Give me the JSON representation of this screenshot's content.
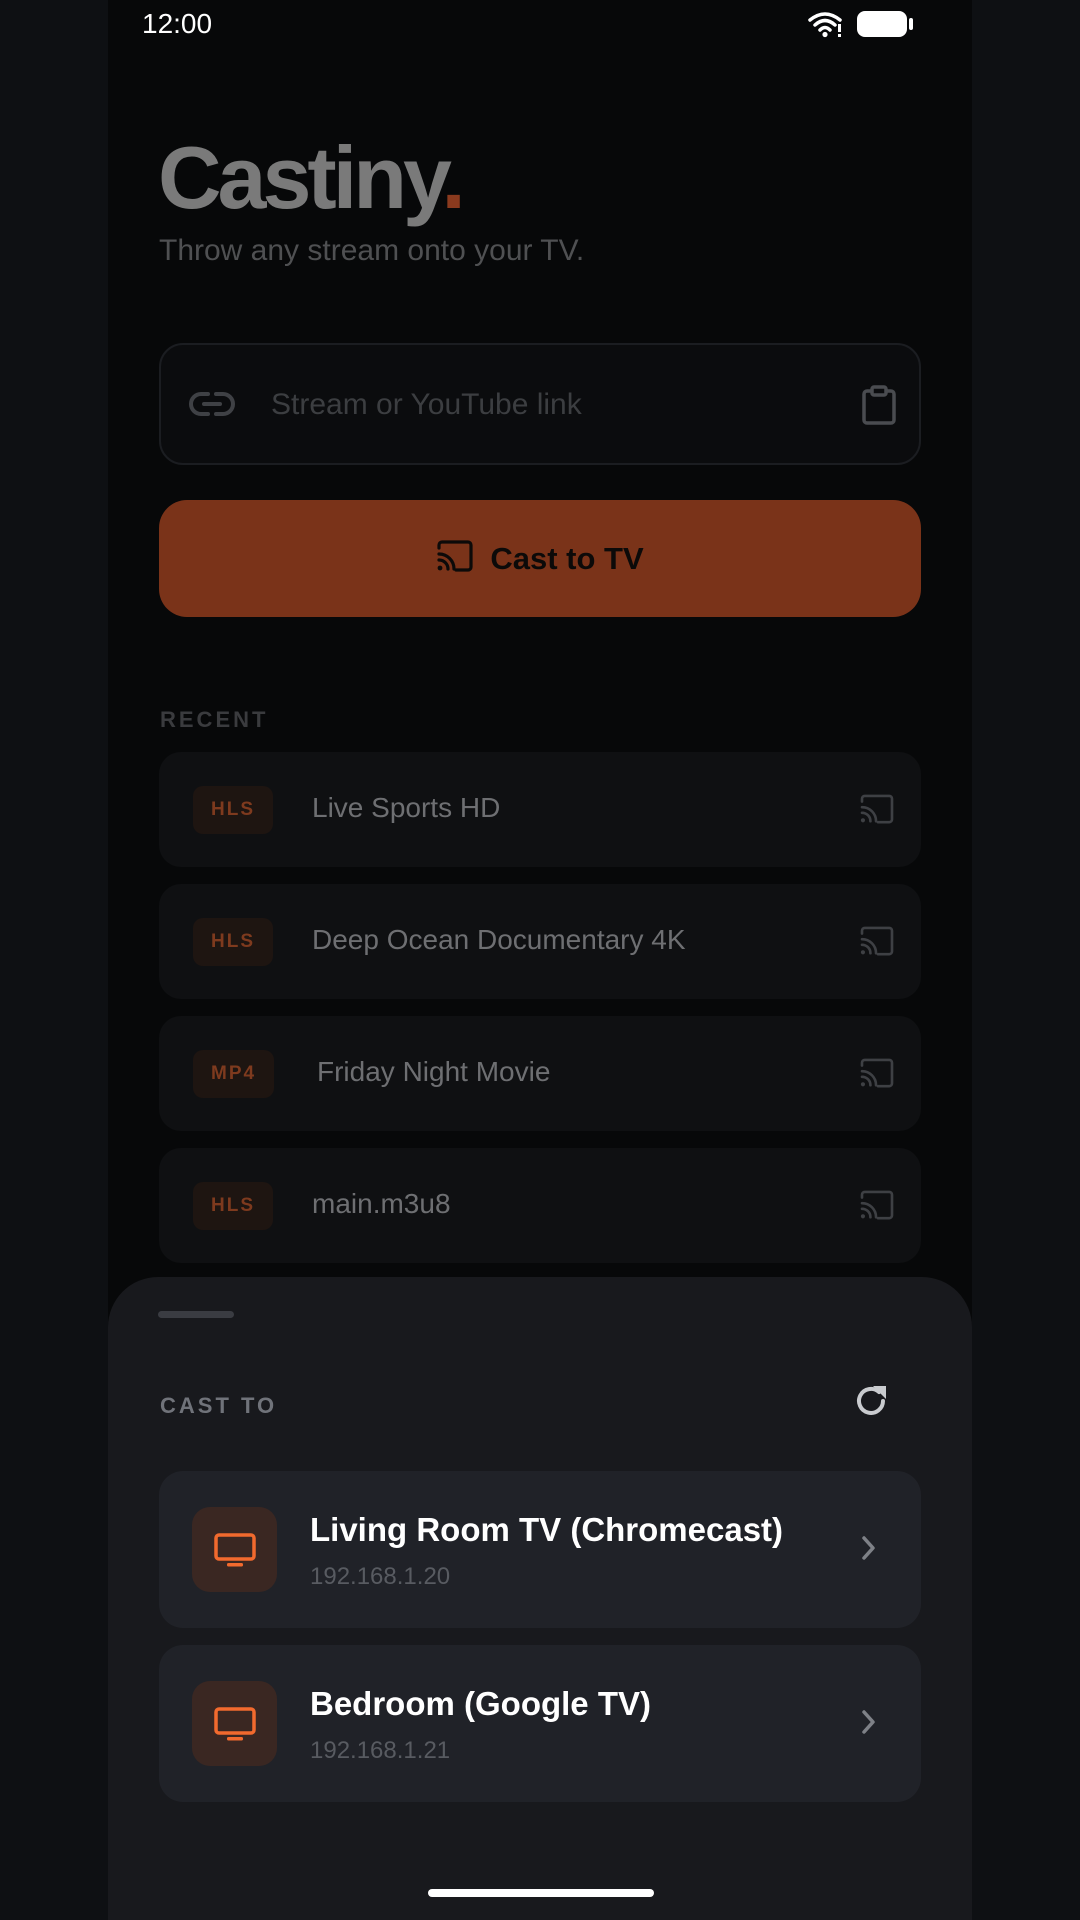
{
  "status": {
    "time": "12:00"
  },
  "brand": {
    "name": "Castiny",
    "dot": ".",
    "tagline": "Throw any stream onto your TV."
  },
  "input": {
    "placeholder": "Stream or YouTube link",
    "value": ""
  },
  "cast_button": {
    "label": "Cast to TV"
  },
  "recent": {
    "label": "RECENT",
    "items": [
      {
        "badge": "HLS",
        "title": "Live Sports HD"
      },
      {
        "badge": "HLS",
        "title": "Deep Ocean Documentary 4K"
      },
      {
        "badge": "MP4",
        "title": "Friday Night Movie"
      },
      {
        "badge": "HLS",
        "title": "main.m3u8"
      }
    ]
  },
  "sheet": {
    "label": "CAST TO",
    "devices": [
      {
        "name": "Living Room TV (Chromecast)",
        "ip": "192.168.1.20"
      },
      {
        "name": "Bedroom (Google TV)",
        "ip": "192.168.1.21"
      }
    ]
  },
  "colors": {
    "accent": "#f26a2e",
    "button": "#7a3319",
    "sheet": "#18191d"
  }
}
